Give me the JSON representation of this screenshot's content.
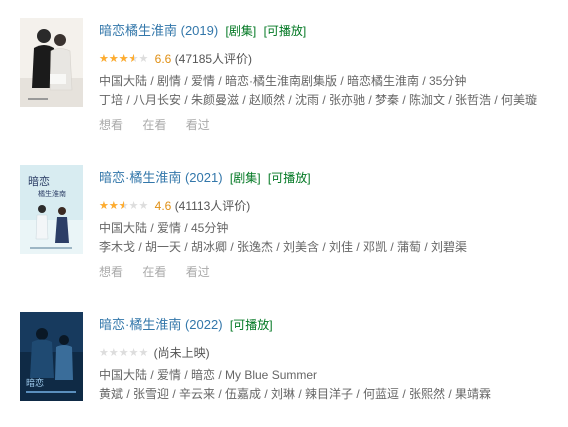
{
  "results": [
    {
      "title": "暗恋橘生淮南 (2019)",
      "tags": [
        "[剧集]",
        "[可播放]"
      ],
      "rating": 3.5,
      "score": "6.6",
      "votes": "(47185人评价)",
      "meta": "中国大陆 / 剧情 / 爱情 / 暗恋·橘生淮南剧集版 / 暗恋橘生淮南 / 35分钟",
      "cast": "丁培 / 八月长安 / 朱颜曼滋 / 赵顺然 / 沈雨 / 张亦驰 / 梦秦 / 陈泇文 / 张哲浩 / 何美璇",
      "actions": [
        "想看",
        "在看",
        "看过"
      ],
      "poster": {
        "bg": "#f4f1ec",
        "figure_a": "#1b1b1b",
        "figure_b": "#e8e6e2"
      }
    },
    {
      "title": "暗恋·橘生淮南 (2021)",
      "tags": [
        "[剧集]",
        "[可播放]"
      ],
      "rating": 2.5,
      "score": "4.6",
      "votes": "(41113人评价)",
      "meta": "中国大陆 / 爱情 / 45分钟",
      "cast": "李木戈 / 胡一天 / 胡冰卿 / 张逸杰 / 刘美含 / 刘佳 / 邓凯 / 蒲萄 / 刘碧渠",
      "actions": [
        "想看",
        "在看",
        "看过"
      ],
      "poster": {
        "bg": "#d8ecf1",
        "figure_a": "#2c3e66",
        "figure_b": "#f3f6f8"
      }
    },
    {
      "title": "暗恋·橘生淮南 (2022)",
      "tags": [
        "[可播放]"
      ],
      "rating": 0,
      "noscore": "(尚未上映)",
      "meta": "中国大陆 / 爱情 / 暗恋 / My Blue Summer",
      "cast": "黄斌 / 张雪迎 / 辛云来 / 伍嘉成 / 刘琳 / 辣目洋子 / 何蓝逗 / 张熙然 / 果靖霖",
      "actions": [],
      "poster": {
        "bg": "#0f2a45",
        "figure_a": "#3a6d9a",
        "figure_b": "#9cc8ea"
      }
    }
  ],
  "icons": {
    "star": "★",
    "star_color": "#ffac2d",
    "star_empty_color": "#dddddd"
  },
  "colors": {
    "title_link": "#3377aa",
    "tag_green": "#007722",
    "score_orange": "#e09015",
    "action_grey": "#aaaaaa"
  }
}
